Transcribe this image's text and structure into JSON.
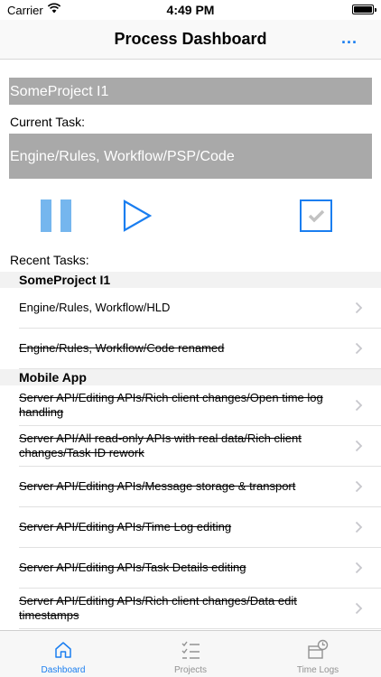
{
  "status_bar": {
    "carrier": "Carrier",
    "time": "4:49 PM"
  },
  "nav": {
    "title": "Process Dashboard",
    "more": "..."
  },
  "project": {
    "name": "SomeProject I1"
  },
  "current_task": {
    "label": "Current Task:",
    "value": "Engine/Rules, Workflow/PSP/Code"
  },
  "recent": {
    "label": "Recent Tasks:"
  },
  "sections": [
    {
      "header": "SomeProject I1",
      "rows": [
        {
          "text": "Engine/Rules, Workflow/HLD",
          "completed": false,
          "h": 45
        },
        {
          "text": "Engine/Rules, Workflow/Code renamed",
          "completed": true,
          "h": 45
        }
      ]
    },
    {
      "header": "Mobile App",
      "rows": [
        {
          "text": "Server API/Editing APIs/Rich client changes/Open time log handling",
          "completed": true,
          "h": 45
        },
        {
          "text": "Server API/All read-only APIs with real data/Rich client changes/Task ID rework",
          "completed": true,
          "h": 45
        },
        {
          "text": "Server API/Editing APIs/Message storage & transport",
          "completed": true,
          "h": 45
        },
        {
          "text": "Server API/Editing APIs/Time Log editing",
          "completed": true,
          "h": 45
        },
        {
          "text": "Server API/Editing APIs/Task Details editing",
          "completed": true,
          "h": 45
        },
        {
          "text": "Server API/Editing APIs/Rich client changes/Data edit timestamps",
          "completed": true,
          "h": 45
        }
      ]
    }
  ],
  "tabs": [
    {
      "label": "Dashboard",
      "icon": "home-icon",
      "active": true
    },
    {
      "label": "Projects",
      "icon": "checklist-icon",
      "active": false
    },
    {
      "label": "Time Logs",
      "icon": "time-log-icon",
      "active": false
    }
  ],
  "colors": {
    "accent": "#1a7ef0",
    "pause": "#75b6ee",
    "bar": "#a9a9a9",
    "inactive": "#929292"
  }
}
